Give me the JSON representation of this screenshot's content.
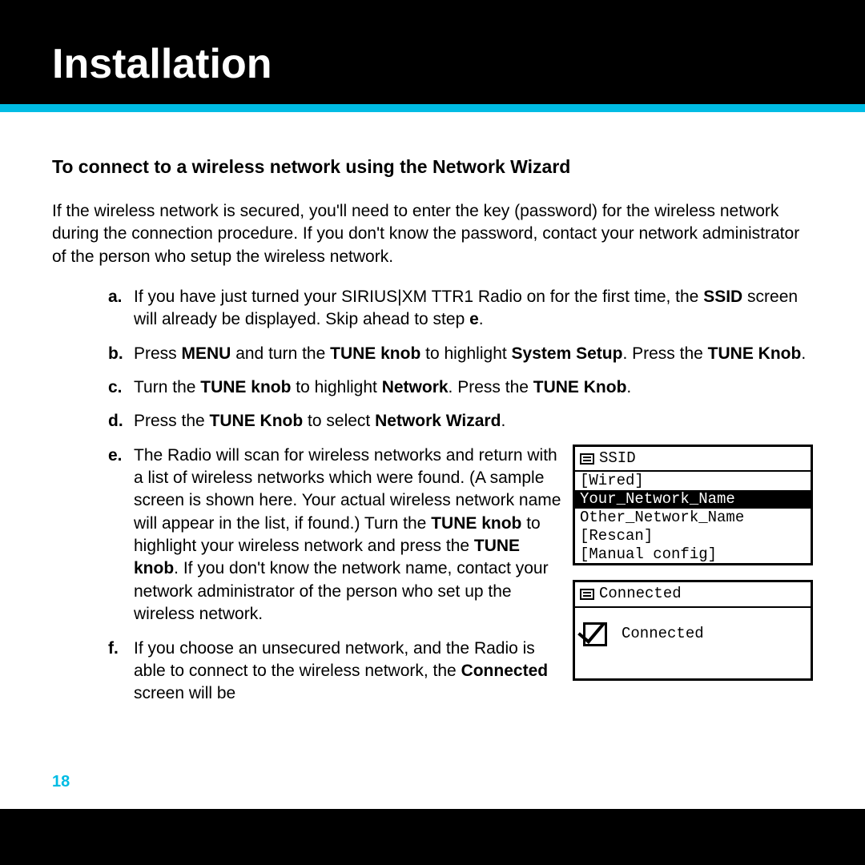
{
  "header": {
    "title": "Installation"
  },
  "subhead": "To connect to a wireless network using the Network Wizard",
  "intro": "If the wireless network is secured, you'll need to enter the key (password) for the wireless network during the connection procedure. If you don't know the password, contact your network administrator of the person who setup the wireless network.",
  "steps": {
    "a": {
      "marker": "a.",
      "pre": "If you have just turned your SIRIUS|XM TTR1 Radio on for the first time, the ",
      "b1": "SSID",
      "mid": " screen will already be displayed. Skip ahead to step ",
      "b2": "e",
      "post": "."
    },
    "b": {
      "marker": "b.",
      "pre": "Press ",
      "b1": "MENU",
      "mid1": " and turn the ",
      "b2": "TUNE knob",
      "mid2": " to highlight ",
      "b3": "System Setup",
      "mid3": ". Press the ",
      "b4": "TUNE Knob",
      "post": "."
    },
    "c": {
      "marker": "c.",
      "pre": "Turn the ",
      "b1": "TUNE knob",
      "mid1": " to highlight ",
      "b2": "Network",
      "mid2": ". Press the ",
      "b3": "TUNE Knob",
      "post": "."
    },
    "d": {
      "marker": "d.",
      "pre": "Press the ",
      "b1": "TUNE Knob",
      "mid1": " to select ",
      "b2": "Network Wizard",
      "post": "."
    },
    "e": {
      "marker": "e.",
      "pre": "The Radio will scan for wireless networks and return with a list of wireless networks which were found. (A sample screen is shown here. Your actual wireless network name will appear in the list, if found.) Turn the ",
      "b1": "TUNE knob",
      "mid1": " to highlight your wireless network and press the ",
      "b2": "TUNE knob",
      "post": ". If you don't know the network name, contact your network administrator of the person who set up the wireless network."
    },
    "f": {
      "marker": "f.",
      "pre": "If you choose an unsecured network, and the Radio is able to connect to the wireless network, the ",
      "b1": "Connected",
      "post": " screen will be"
    }
  },
  "screen_ssid": {
    "title": "SSID",
    "rows": [
      {
        "text": "[Wired]",
        "selected": false
      },
      {
        "text": "Your_Network_Name",
        "selected": true
      },
      {
        "text": "Other_Network_Name",
        "selected": false
      },
      {
        "text": "[Rescan]",
        "selected": false
      },
      {
        "text": "[Manual config]",
        "selected": false
      }
    ]
  },
  "screen_connected": {
    "title": "Connected",
    "label": "Connected"
  },
  "page_number": "18"
}
